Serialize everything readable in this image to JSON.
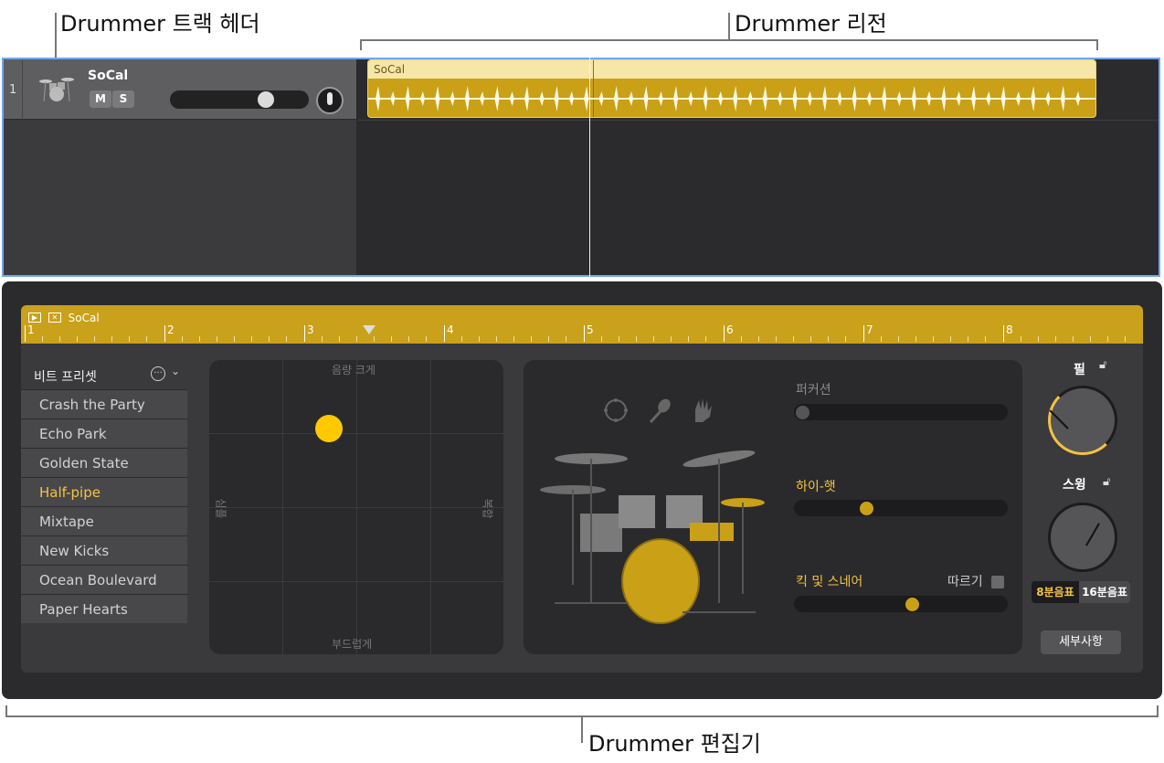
{
  "callouts": {
    "track_header": "Drummer 트랙 헤더",
    "region": "Drummer 리전",
    "editor": "Drummer 편집기"
  },
  "track": {
    "number": "1",
    "name": "SoCal",
    "mute": "M",
    "solo": "S",
    "region_name": "SoCal"
  },
  "editor": {
    "region_name": "SoCal",
    "ruler": [
      "1",
      "2",
      "3",
      "4",
      "5",
      "6",
      "7",
      "8"
    ],
    "presets": {
      "header": "비트 프리셋",
      "items": [
        "Crash the Party",
        "Echo Park",
        "Golden State",
        "Half-pipe",
        "Mixtape",
        "New Kicks",
        "Ocean Boulevard",
        "Paper Hearts"
      ],
      "selected": "Half-pipe"
    },
    "xy_pad": {
      "top": "음량 크게",
      "bottom": "부드럽게",
      "left": "심플",
      "right": "복합"
    },
    "kit": {
      "percussion": "퍼커션",
      "hihat": "하이-햇",
      "kick_snare": "킥 및 스네어",
      "follow": "따르기"
    },
    "fill": "필",
    "swing": "스윙",
    "notes": [
      "8분음표",
      "16분음표"
    ],
    "details": "세부사항"
  },
  "colors": {
    "accent": "#f5c242",
    "region": "#caa017",
    "selection": "#6fa6ef"
  }
}
